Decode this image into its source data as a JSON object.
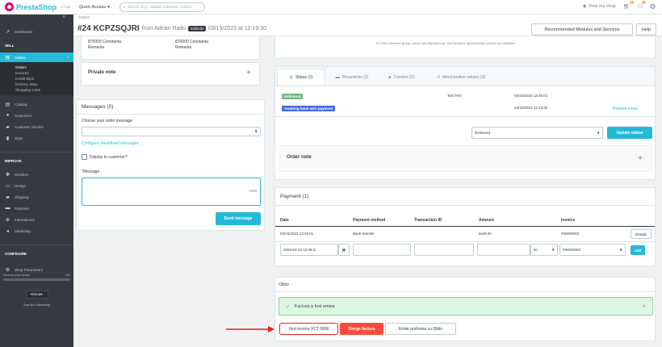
{
  "topbar": {
    "brand": "PrestaShop",
    "version": "1.7.8.8",
    "quick_access": "Quick Access",
    "search_placeholder": "Search (e.g.: product reference, custom",
    "view_shop": "View my shop",
    "notif1": "5",
    "notif2": "3"
  },
  "sidebar": {
    "dashboard": "Dashboard",
    "sell": "SELL",
    "orders": "Orders",
    "orders_sub": [
      "Orders",
      "Invoices",
      "Credit Slips",
      "Delivery Slips",
      "Shopping Carts"
    ],
    "catalog": "Catalog",
    "customers": "Customers",
    "customer_service": "Customer Service",
    "stats": "Stats",
    "improve": "IMPROVE",
    "modules": "Modules",
    "design": "Design",
    "shipping": "Shipping",
    "payment": "Payment",
    "international": "International",
    "marketing": "Marketing",
    "configure": "CONFIGURE",
    "shop_params": "Shop Parameters",
    "launch": "Launch your shop!",
    "launch_pct": "0%",
    "resume": "RESUME",
    "stop": "Stop the OnBoarding"
  },
  "header": {
    "breadcrumb": "Orders",
    "order_num": "#24 KCPZSQJRI",
    "from": "from Adrian Radu",
    "total": "lei29.00",
    "date": "03/15/2023 at 12:19:30",
    "btn_rec": "Recommended Modules and Services",
    "btn_help": "Help"
  },
  "address": {
    "left_city": "870000 Constanta",
    "left_country": "Romania",
    "right_city": "870000 Constanta",
    "right_country": "Romania"
  },
  "private_note": {
    "title": "Private note",
    "plus": "+"
  },
  "messages": {
    "title": "Messages (0)",
    "choose": "Choose your order message",
    "configure": "Configure predefined messages →",
    "display": "Display to customer?",
    "message_label": "*Message",
    "counter": "1200",
    "send": "Send message"
  },
  "right_top": {
    "notice": "For this customer group, prices are displayed as: Tax included. Merchandise returns are disabled"
  },
  "tabs": {
    "status": "Status (2)",
    "documents": "Documents (2)",
    "carriers": "Carriers (1)",
    "returns": "Merchandise returns (0)"
  },
  "status_rows": [
    {
      "label": "Delivered",
      "color": "#70b580",
      "who": "Test Test",
      "date": "03/15/2023 12:45:01",
      "action": ""
    },
    {
      "label": "Awaiting bank wire payment",
      "color": "#4169e1",
      "who": "",
      "date": "03/15/2023 12:19:30",
      "action": "Resend email"
    }
  ],
  "status_select": "Delivered",
  "update_btn": "Update status",
  "order_note": {
    "title": "Order note",
    "plus": "+"
  },
  "payment": {
    "title": "Payment (1)",
    "headers": [
      "Date",
      "Payment method",
      "Transaction ID",
      "Amount",
      "Invoice"
    ],
    "row": [
      "03/15/2023 12:45:01",
      "Bank transfer",
      "",
      "lei29.00",
      "#IN000003"
    ],
    "details": "Details",
    "date_input": "2023-03-15 12:48:1!",
    "currency": "lei",
    "invoice_sel": "#IN000003",
    "add": "Add"
  },
  "oblio": {
    "title": "Oblio",
    "alert": "Factura a fost emisa",
    "close": "×",
    "btn_view": "Vezi invoice FCT 0666",
    "btn_delete": "Sterge factura",
    "btn_proforma": "Emite proforma cu Oblio"
  },
  "colors": {
    "accent": "#25b9d7",
    "danger": "#f54c3e",
    "success": "#70b580"
  }
}
